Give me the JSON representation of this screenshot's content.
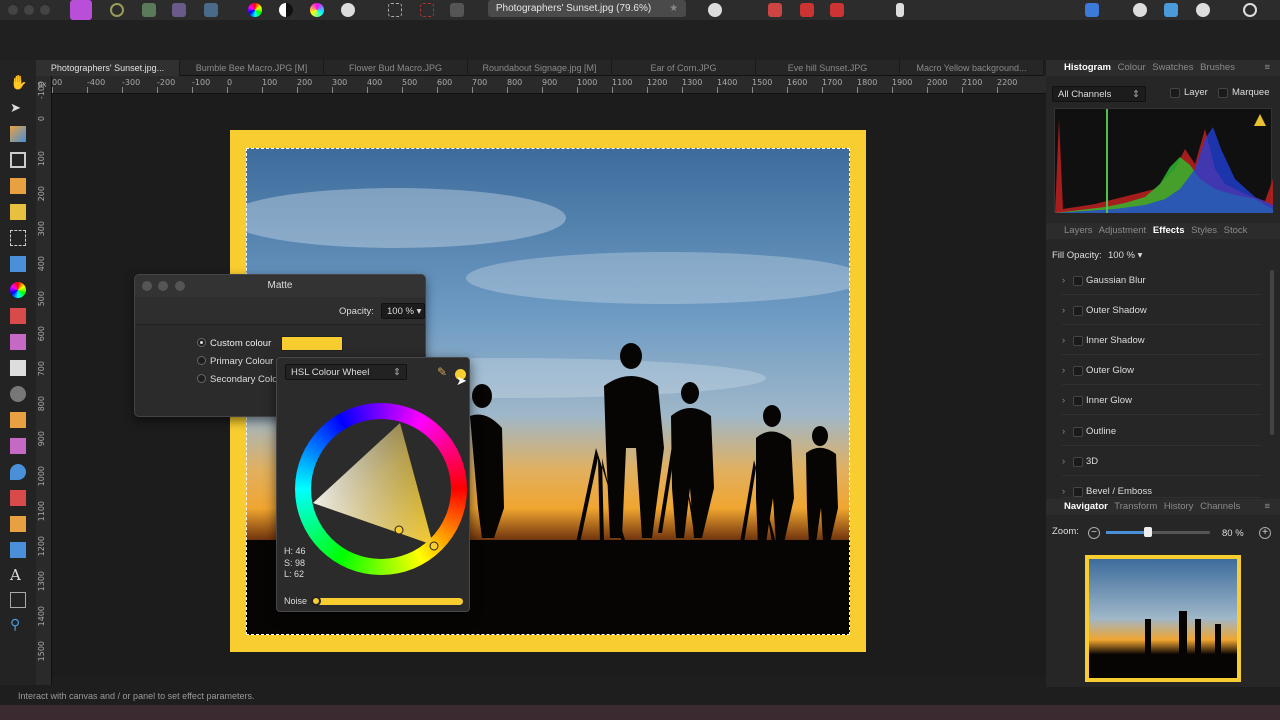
{
  "toolbar": {
    "doc_title": "Photographers' Sunset.jpg (79.6%)",
    "star": "★"
  },
  "doc_tabs": [
    "Photographers' Sunset.jpg...",
    "Bumble Bee Macro.JPG [M]",
    "Flower Bud Macro.JPG",
    "Roundabout Signage.jpg [M]",
    "Ear of Corn.JPG",
    "Eve hill Sunset.JPG",
    "Macro Yellow background..."
  ],
  "ruler": {
    "unit": "px",
    "h_labels": [
      "00",
      "-400",
      "-300",
      "-200",
      "-100",
      "0",
      "100",
      "200",
      "300",
      "400",
      "500",
      "600",
      "700",
      "800",
      "900",
      "1000",
      "1100",
      "1200",
      "1300",
      "1400",
      "1500",
      "1600",
      "1700",
      "1800",
      "1900",
      "2000",
      "2100",
      "2200"
    ],
    "v_labels": [
      "-100",
      "0",
      "100",
      "200",
      "300",
      "400",
      "500",
      "600",
      "700",
      "800",
      "900",
      "1000",
      "1100",
      "1200",
      "1300",
      "1400",
      "1500"
    ]
  },
  "matte_dialog": {
    "title": "Matte",
    "opacity_label": "Opacity:",
    "opacity_value": "100 %",
    "options": [
      "Custom colour",
      "Primary Colour",
      "Secondary Colo"
    ],
    "custom_colour": "#f7cd2f"
  },
  "colour_picker": {
    "mode": "HSL Colour Wheel",
    "h": "H: 46",
    "s": "S: 98",
    "l": "L: 62",
    "noise_label": "Noise"
  },
  "right_panel": {
    "top_tabs": [
      "Histogram",
      "Colour",
      "Swatches",
      "Brushes"
    ],
    "channels": "All Channels",
    "layer_label": "Layer",
    "marquee_label": "Marquee",
    "mid_tabs": [
      "Layers",
      "Adjustment",
      "Effects",
      "Styles",
      "Stock"
    ],
    "fill_label": "Fill Opacity:",
    "fill_value": "100 %",
    "effects": [
      "Gaussian Blur",
      "Outer Shadow",
      "Inner Shadow",
      "Outer Glow",
      "Inner Glow",
      "Outline",
      "3D",
      "Bevel / Emboss"
    ],
    "nav_tabs": [
      "Navigator",
      "Transform",
      "History",
      "Channels"
    ],
    "zoom_label": "Zoom:",
    "zoom_value": "80 %"
  },
  "status": {
    "text": "Interact with canvas and / or panel to set effect parameters."
  },
  "colors": {
    "matte": "#f7cd2f",
    "panel": "#262626"
  }
}
